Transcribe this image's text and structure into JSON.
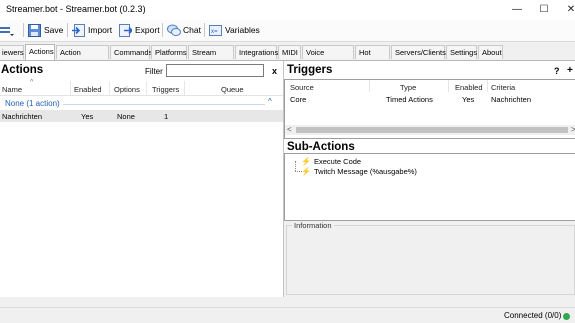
{
  "window": {
    "title": "Streamer.bot - Streamer.bot (0.2.3)"
  },
  "toolbar": {
    "save": "Save",
    "import": "Import",
    "export": "Export",
    "chat": "Chat",
    "variables": "Variables"
  },
  "tabs": [
    {
      "label": "iewers"
    },
    {
      "label": "Actions"
    },
    {
      "label": "Action Queues"
    },
    {
      "label": "Commands"
    },
    {
      "label": "Platforms"
    },
    {
      "label": "Stream Apps"
    },
    {
      "label": "Integrations"
    },
    {
      "label": "MIDI"
    },
    {
      "label": "Voice Control"
    },
    {
      "label": "Hot Keys"
    },
    {
      "label": "Servers/Clients"
    },
    {
      "label": "Settings"
    },
    {
      "label": "About"
    }
  ],
  "actions": {
    "title": "Actions",
    "filter_label": "Filter",
    "filter_value": "",
    "clear": "x",
    "columns": [
      "Name",
      "Enabled",
      "Options",
      "Triggers",
      "Queue"
    ],
    "group": "None (1 action)",
    "rows": [
      {
        "name": "Nachrichten",
        "enabled": "Yes",
        "options": "None",
        "triggers": "1",
        "queue": ""
      }
    ]
  },
  "triggers": {
    "title": "Triggers",
    "help": "?",
    "add": "+",
    "columns": [
      "Source",
      "Type",
      "Enabled",
      "Criteria"
    ],
    "rows": [
      {
        "source": "Core",
        "type": "Timed Actions",
        "enabled": "Yes",
        "criteria": "Nachrichten"
      }
    ]
  },
  "subactions": {
    "title": "Sub-Actions",
    "items": [
      "Execute Code",
      "Twitch Message (%ausgabe%)"
    ]
  },
  "information": {
    "label": "Information"
  },
  "status": {
    "text": "Connected (0/0)"
  },
  "colors": {
    "accent": "#1e5fb4",
    "status_dot": "#2fa84f"
  }
}
